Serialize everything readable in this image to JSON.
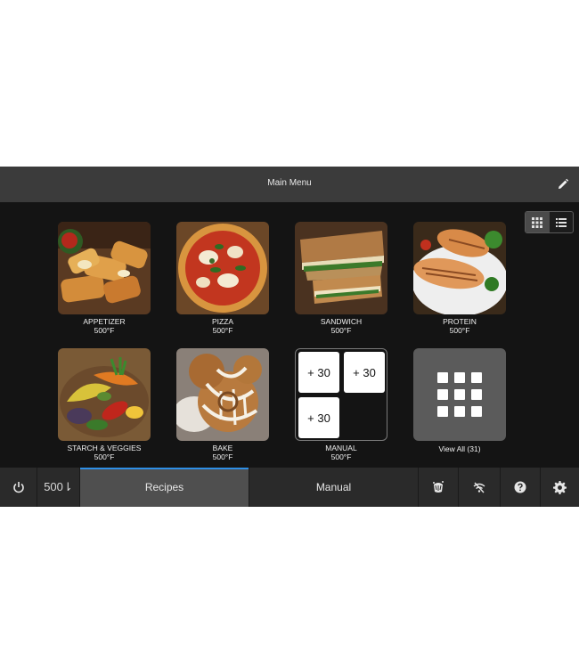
{
  "header": {
    "title": "Main Menu"
  },
  "tiles": [
    {
      "name": "APPETIZER",
      "temp": "500°F"
    },
    {
      "name": "PIZZA",
      "temp": "500°F"
    },
    {
      "name": "SANDWICH",
      "temp": "500°F"
    },
    {
      "name": "PROTEIN",
      "temp": "500°F"
    },
    {
      "name": "STARCH & VEGGIES",
      "temp": "500°F"
    },
    {
      "name": "BAKE",
      "temp": "500°F"
    },
    {
      "name": "MANUAL",
      "temp": "500°F",
      "buttons": [
        "+ 30",
        "+ 30",
        "+ 30"
      ]
    },
    {
      "name": "View All (31)"
    }
  ],
  "bottombar": {
    "temperature": "500⇂",
    "tabs": [
      "Recipes",
      "Manual"
    ],
    "active_tab": "Recipes"
  },
  "colors": {
    "accent": "#2f8fe6",
    "screen_bg": "#141414",
    "bar_bg": "#3b3b3b"
  }
}
